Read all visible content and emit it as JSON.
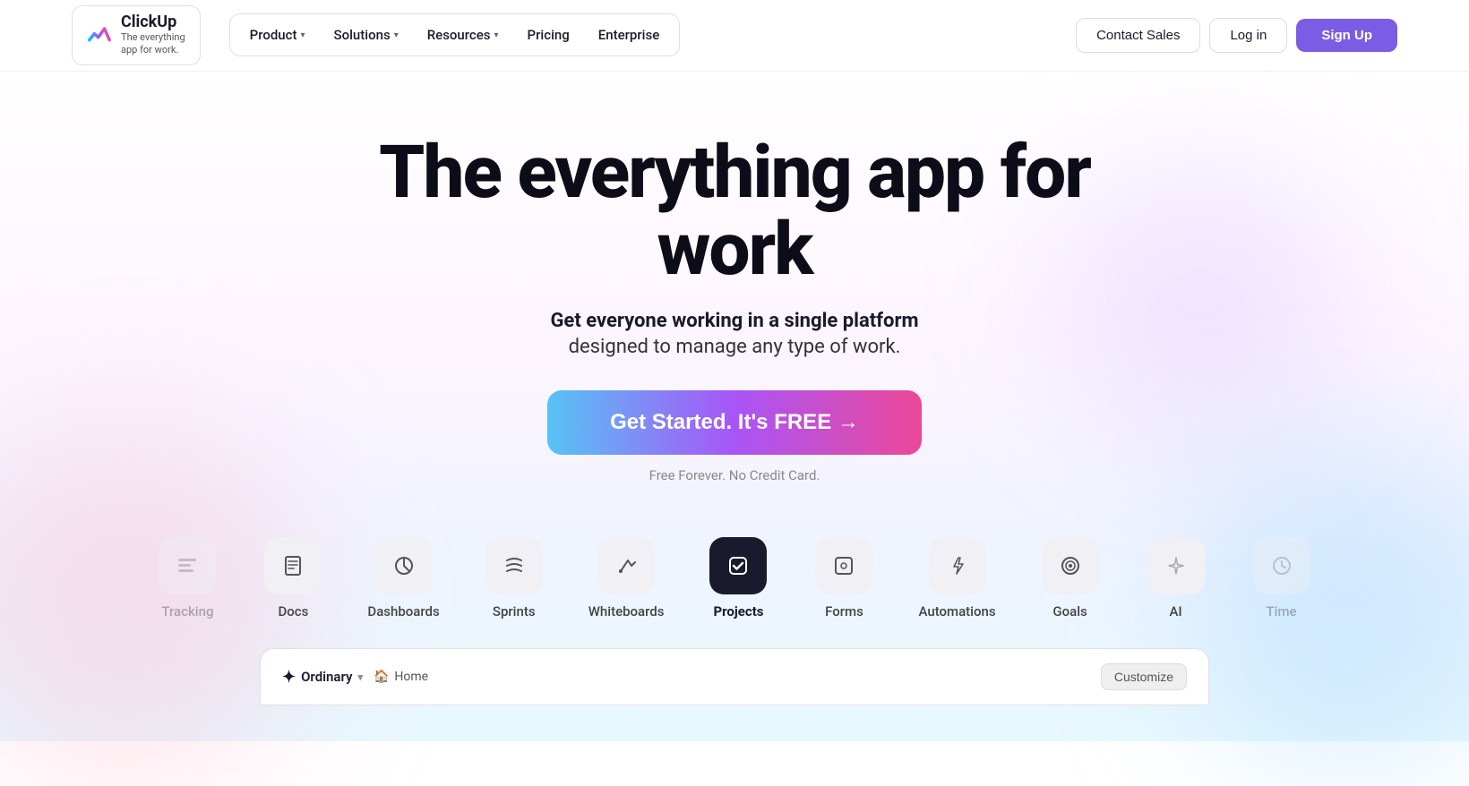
{
  "nav": {
    "logo": {
      "name": "ClickUp",
      "tagline": "The everything\napp for work."
    },
    "links": [
      {
        "label": "Product",
        "hasDropdown": true
      },
      {
        "label": "Solutions",
        "hasDropdown": true
      },
      {
        "label": "Resources",
        "hasDropdown": true
      },
      {
        "label": "Pricing",
        "hasDropdown": false
      },
      {
        "label": "Enterprise",
        "hasDropdown": false
      }
    ],
    "contact_sales": "Contact Sales",
    "login": "Log in",
    "signup": "Sign Up"
  },
  "hero": {
    "title": "The everything app for work",
    "subtitle_line1": "Get everyone working in a single platform",
    "subtitle_line2": "designed to manage any type of work.",
    "cta_label": "Get Started. It's FREE →",
    "cta_sub": "Free Forever. No Credit Card."
  },
  "feature_tabs": [
    {
      "id": "tracking",
      "label": "Tracking",
      "icon": "⊟",
      "active": false,
      "faded": true
    },
    {
      "id": "docs",
      "label": "Docs",
      "icon": "≡",
      "active": false,
      "faded": false
    },
    {
      "id": "dashboards",
      "label": "Dashboards",
      "icon": "◑",
      "active": false,
      "faded": false
    },
    {
      "id": "sprints",
      "label": "Sprints",
      "icon": "≋",
      "active": false,
      "faded": false
    },
    {
      "id": "whiteboards",
      "label": "Whiteboards",
      "icon": "✐",
      "active": false,
      "faded": false
    },
    {
      "id": "projects",
      "label": "Projects",
      "icon": "✓",
      "active": true,
      "faded": false
    },
    {
      "id": "forms",
      "label": "Forms",
      "icon": "⊡",
      "active": false,
      "faded": false
    },
    {
      "id": "automations",
      "label": "Automations",
      "icon": "⚡",
      "active": false,
      "faded": false
    },
    {
      "id": "goals",
      "label": "Goals",
      "icon": "⊙",
      "active": false,
      "faded": false
    },
    {
      "id": "ai",
      "label": "AI",
      "icon": "✦",
      "active": false,
      "faded": false
    },
    {
      "id": "time",
      "label": "Time",
      "icon": "⏱",
      "active": false,
      "faded": true
    }
  ],
  "bottom_preview": {
    "workspace_name": "Ordinary",
    "breadcrumb": "Home",
    "customize_label": "Customize"
  }
}
